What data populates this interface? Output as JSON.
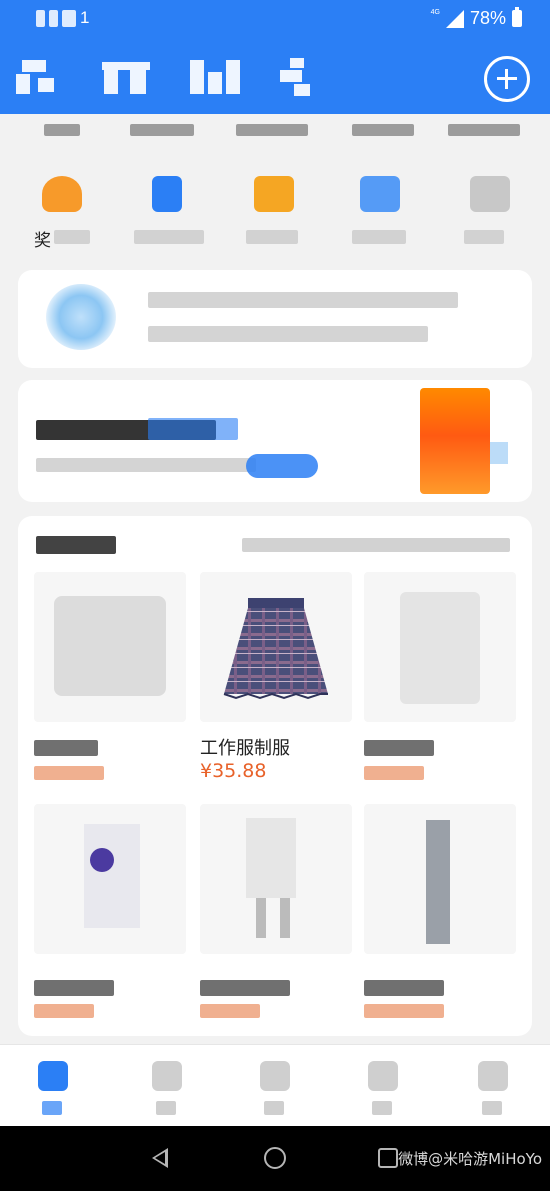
{
  "status_bar": {
    "sim_indicator": "1",
    "network": "4G",
    "battery": "78%"
  },
  "header": {
    "icons": [
      "blurred-nav-tab",
      "blurred-nav-tab",
      "blurred-nav-tab",
      "blurred-nav-tab",
      "add-circle-icon"
    ]
  },
  "categories": {
    "first_label": "奖",
    "colors": [
      "#f79a2a",
      "#2b7ff5",
      "#f5a623",
      "#3a8cf7",
      "#c8c8c8"
    ]
  },
  "recommend": {
    "product": {
      "name": "工作服制服",
      "price": "¥35.88"
    }
  },
  "colors": {
    "primary": "#2b7ff5",
    "price": "#e8622a",
    "background": "#f2f2f2"
  },
  "watermark": "微博@米哈游MiHoYo"
}
